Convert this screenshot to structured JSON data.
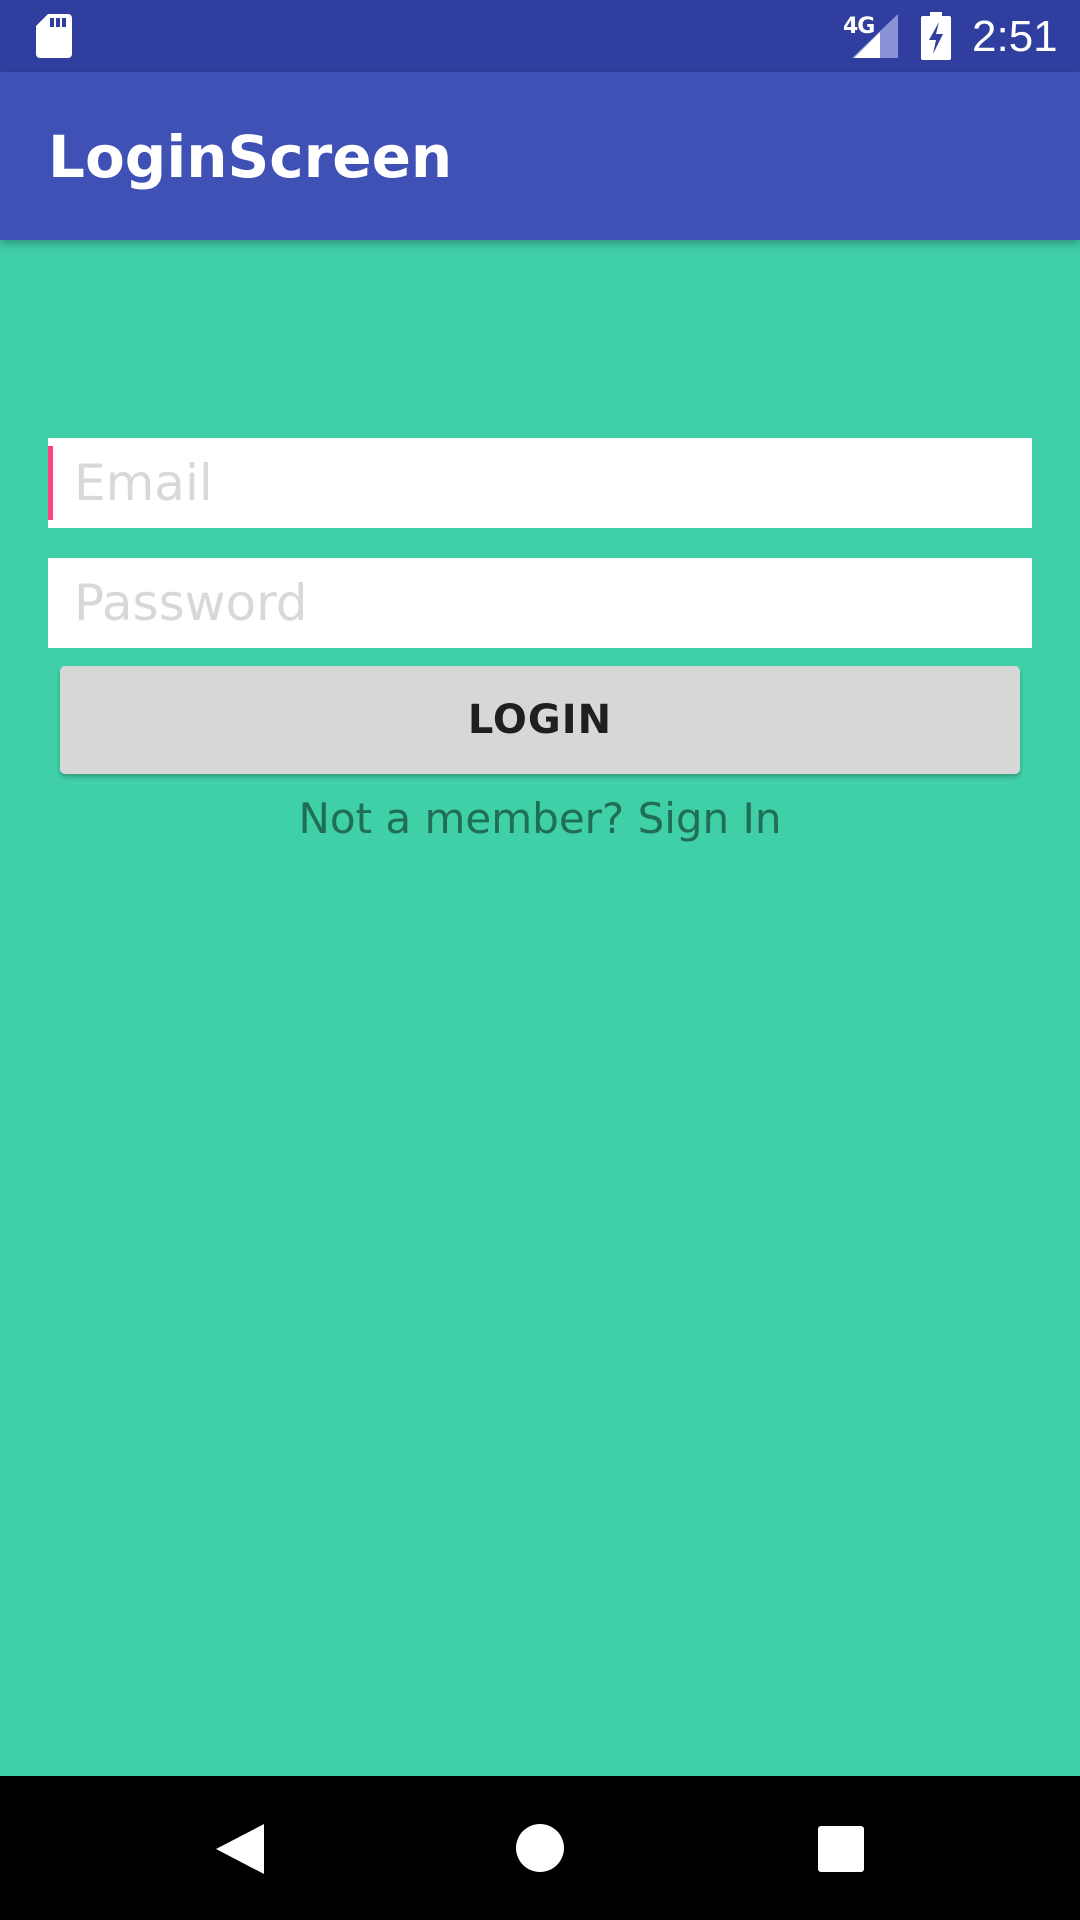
{
  "status_bar": {
    "network": "4G",
    "time": "2:51",
    "icons": [
      "sd-card-icon",
      "cell-signal-icon",
      "battery-charging-icon"
    ]
  },
  "app_bar": {
    "title": "LoginScreen"
  },
  "form": {
    "email_placeholder": "Email",
    "password_placeholder": "Password",
    "login_label": "LOGIN",
    "signup_text": "Not a member? Sign In"
  },
  "nav_bar": {
    "icons": [
      "back-icon",
      "home-icon",
      "recents-icon"
    ]
  },
  "colors": {
    "status_bar": "#303f9f",
    "app_bar": "#3f51b5",
    "background": "#40d0a8",
    "accent": "#ff4081",
    "button": "#d6d7d7"
  }
}
